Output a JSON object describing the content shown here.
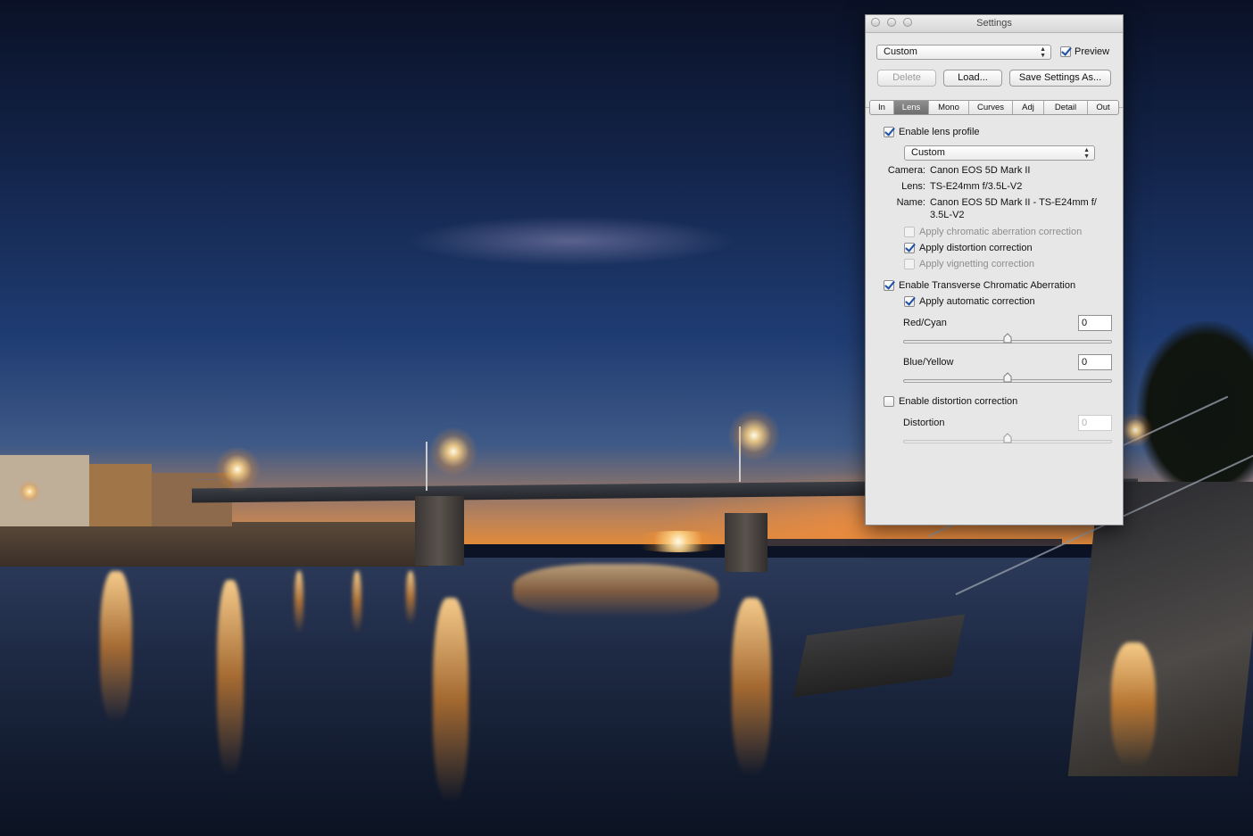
{
  "window": {
    "title": "Settings"
  },
  "preset": {
    "selected": "Custom",
    "preview_label": "Preview",
    "preview_checked": true
  },
  "buttons": {
    "delete": "Delete",
    "load": "Load...",
    "save": "Save Settings As..."
  },
  "tabs": [
    {
      "label": "In",
      "active": false
    },
    {
      "label": "Lens",
      "active": true
    },
    {
      "label": "Mono",
      "active": false
    },
    {
      "label": "Curves",
      "active": false
    },
    {
      "label": "Adj",
      "active": false
    },
    {
      "label": "Detail",
      "active": false
    },
    {
      "label": "Out",
      "active": false
    }
  ],
  "lens": {
    "enable_profile_label": "Enable lens profile",
    "enable_profile_checked": true,
    "profile_selected": "Custom",
    "camera_key": "Camera:",
    "camera_value": "Canon EOS 5D Mark II",
    "lens_key": "Lens:",
    "lens_value": "TS-E24mm f/3.5L-V2",
    "name_key": "Name:",
    "name_value_line1": "Canon EOS 5D Mark II - TS-E24mm f/",
    "name_value_line2": "3.5L-V2",
    "chromatic_label": "Apply chromatic aberration correction",
    "chromatic_checked": false,
    "distortion_label": "Apply distortion correction",
    "distortion_checked": true,
    "vignetting_label": "Apply vignetting correction",
    "vignetting_checked": false
  },
  "tca": {
    "enable_label": "Enable Transverse Chromatic Aberration",
    "enable_checked": true,
    "auto_label": "Apply automatic correction",
    "auto_checked": true,
    "red_cyan_label": "Red/Cyan",
    "red_cyan_value": "0",
    "blue_yellow_label": "Blue/Yellow",
    "blue_yellow_value": "0",
    "red_cyan_slider": 0.5,
    "blue_yellow_slider": 0.5
  },
  "distortion": {
    "enable_label": "Enable distortion correction",
    "enable_checked": false,
    "label": "Distortion",
    "value": "0",
    "slider": 0.5
  }
}
